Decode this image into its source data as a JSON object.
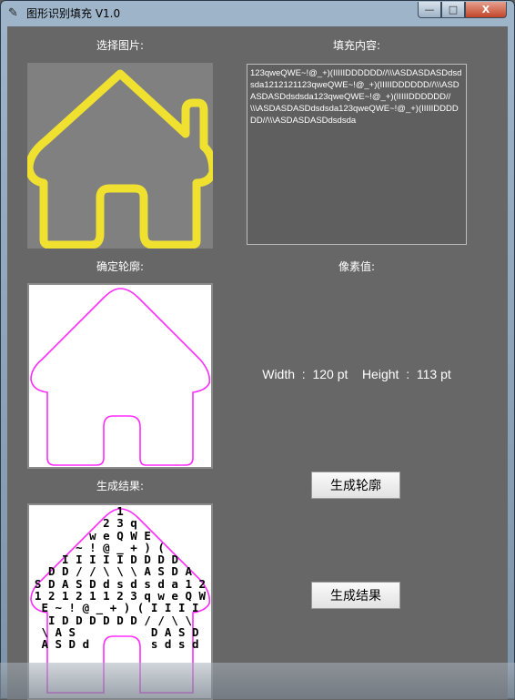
{
  "window": {
    "title": "图形识别填充 V1.0",
    "controls": {
      "minimize": "—",
      "maximize": "□",
      "close": "X"
    }
  },
  "labels": {
    "select_image": "选择图片:",
    "fill_content": "填充内容:",
    "determine_contour": "确定轮廓:",
    "pixel_value": "像素值:",
    "result": "生成结果:"
  },
  "fill_text": "123qweQWE~!@_+)(IIIIIDDDDDD//\\\\\\ASDASDASDdsdsda1212121123qweQWE~!@_+)(IIIIIDDDDDD//\\\\\\ASDASDASDdsdsda123qweQWE~!@_+)(IIIIIDDDDDD//\\\\\\ASDASDASDdsdsda123qweQWE~!@_+)(IIIIIDDDDDD//\\\\\\ASDASDASDdsdsda",
  "pixel_info": "Width  :  120 pt    Height  :  113 pt",
  "buttons": {
    "generate_contour": "生成轮廓",
    "generate_result": "生成结果"
  },
  "result_rows": [
    "1",
    "2 3 q",
    "w e Q W E",
    "~ ! @ _ + ) (",
    "I I I I I D D D D",
    "D D / / \\ \\ \\ A S D A",
    "S D A S D d s d s d a 1 2",
    "1 2 1 2 1 1 2 3 q w e Q W",
    "E ~ ! @ _ + ) ( I I I I",
    "I D D D D D D / / \\ \\",
    "\\ A S           D A S D",
    "A S D d         s d s d"
  ],
  "colors": {
    "client_bg": "#676767",
    "house_yellow": "#f0e130",
    "house_bg": "#808080",
    "contour": "#ff2bff"
  }
}
